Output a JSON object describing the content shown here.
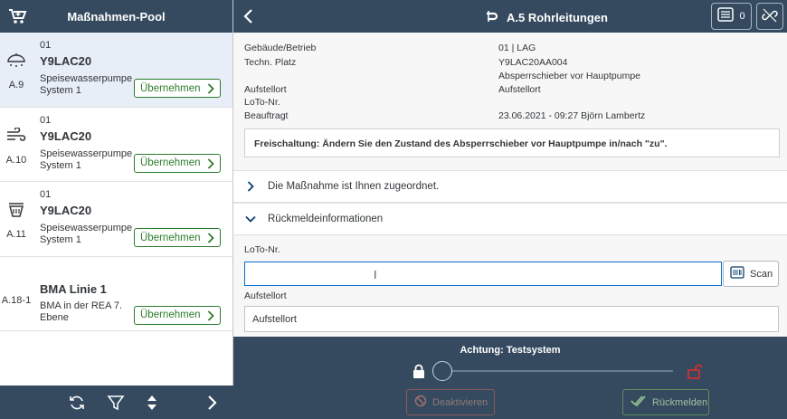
{
  "left": {
    "title": "Maßnahmen-Pool",
    "take_label": "Übernehmen",
    "items": [
      {
        "level": "01",
        "name": "Y9LAC20",
        "desc": "Speisewasserpumpe System 1",
        "code": "A.9",
        "icon": "cloud-snow-icon",
        "selected": true
      },
      {
        "level": "01",
        "name": "Y9LAC20",
        "desc": "Speisewasserpumpe System 1",
        "code": "A.10",
        "icon": "wind-icon",
        "selected": false
      },
      {
        "level": "01",
        "name": "Y9LAC20",
        "desc": "Speisewasserpumpe System 1",
        "code": "A.11",
        "icon": "filter-cup-icon",
        "selected": false
      },
      {
        "level": "",
        "name": "BMA Linie 1",
        "desc": "BMA in der REA 7. Ebene",
        "code": "A.18-1",
        "icon": "",
        "selected": false
      }
    ]
  },
  "header": {
    "title": "A.5 Rohrleitungen",
    "counter": "0"
  },
  "details": {
    "building_label": "Gebäude/Betrieb",
    "building_value": "01 | LAG",
    "place_label": "Techn. Platz",
    "place_value": "Y9LAC20AA004",
    "place_desc": "Absperrschieber vor Hauptpumpe",
    "location_label": "Aufstellort",
    "location_value": "Aufstellort",
    "loto_label": "LoTo-Nr.",
    "assigned_label": "Beauftragt",
    "assigned_value": "23.06.2021 - 09:27 Björn Lambertz",
    "notice": "Freischaltung: Ändern Sie den Zustand des Absperrschieber vor Hauptpumpe in/nach \"zu\"."
  },
  "panels": {
    "assigned": "Die Maßnahme ist Ihnen zugeordnet.",
    "feedback": "Rückmeldeinformationen"
  },
  "feedback": {
    "loto_label": "LoTo-Nr.",
    "loto_value": "",
    "scan_label": "Scan",
    "location_label": "Aufstellort",
    "location_value": "Aufstellort"
  },
  "bottom": {
    "warning": "Achtung: Testsystem",
    "slider_value": 0,
    "deactivate_label": "Deaktivieren",
    "report_label": "Rückmelden"
  },
  "colors": {
    "shell": "#354a5f",
    "accent": "#0a6ed1",
    "positive": "#2b7c2b",
    "negative": "#d32f2f"
  }
}
